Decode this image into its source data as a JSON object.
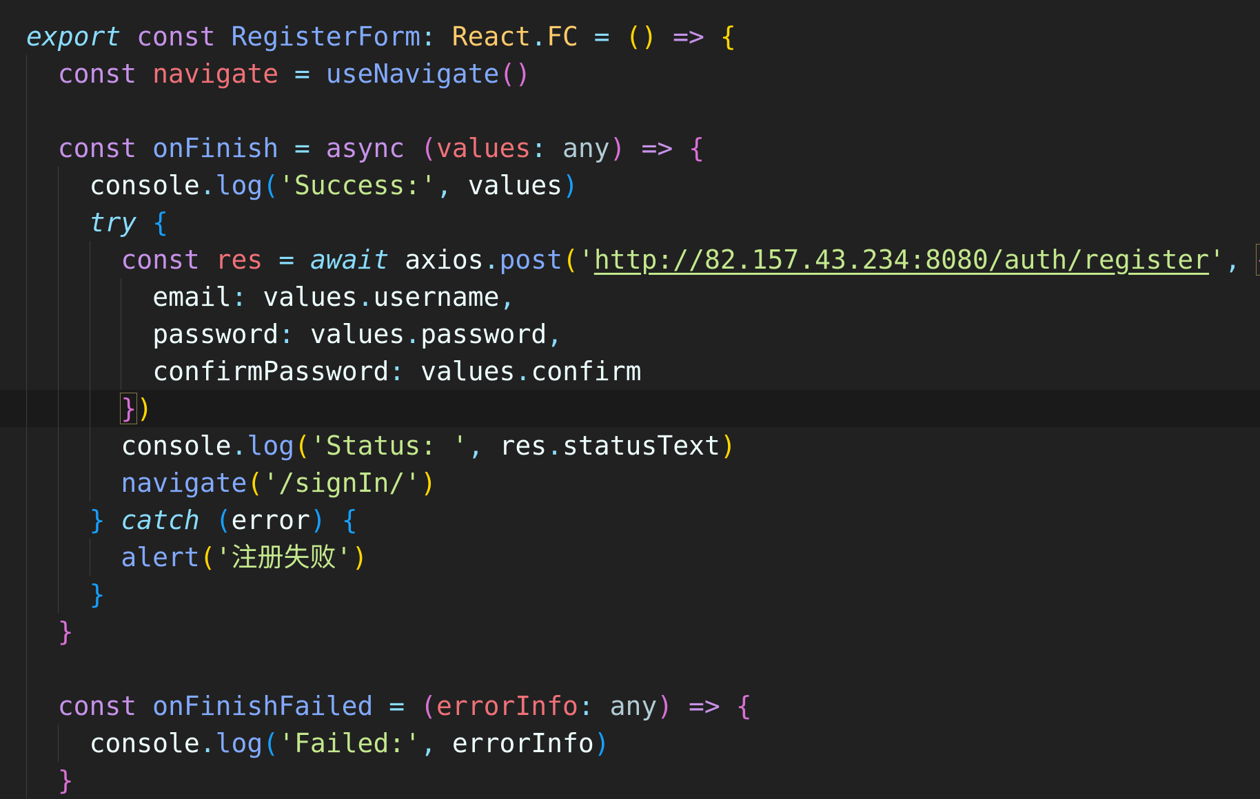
{
  "colors": {
    "background": "#212121",
    "current_line": "#1a1a1a",
    "keyword": "#c792ea",
    "storage_italic": "#89ddff",
    "function": "#82aaff",
    "variable_red": "#f07178",
    "type": "#ffcb6b",
    "string": "#c3e88d",
    "punct": "#89ddff",
    "plain": "#eeffff",
    "bracket_gold": "#ffd700",
    "bracket_pink": "#da70d6",
    "bracket_blue": "#179fff",
    "type_param": "#b2ccd6"
  },
  "editor": {
    "lines": [
      {
        "indent": 0,
        "tokens": [
          {
            "t": "export",
            "c": "storage_italic",
            "i": true
          },
          {
            "t": " "
          },
          {
            "t": "const",
            "c": "keyword"
          },
          {
            "t": " "
          },
          {
            "t": "RegisterForm",
            "c": "function"
          },
          {
            "t": ":",
            "c": "punct"
          },
          {
            "t": " "
          },
          {
            "t": "React",
            "c": "type"
          },
          {
            "t": ".",
            "c": "punct"
          },
          {
            "t": "FC",
            "c": "type"
          },
          {
            "t": " "
          },
          {
            "t": "=",
            "c": "punct"
          },
          {
            "t": " "
          },
          {
            "t": "()",
            "c": "bracket_gold"
          },
          {
            "t": " "
          },
          {
            "t": "=>",
            "c": "keyword"
          },
          {
            "t": " "
          },
          {
            "t": "{",
            "c": "bracket_gold"
          }
        ]
      },
      {
        "indent": 1,
        "tokens": [
          {
            "t": "const",
            "c": "keyword"
          },
          {
            "t": " "
          },
          {
            "t": "navigate",
            "c": "variable_red"
          },
          {
            "t": " "
          },
          {
            "t": "=",
            "c": "punct"
          },
          {
            "t": " "
          },
          {
            "t": "useNavigate",
            "c": "function"
          },
          {
            "t": "()",
            "c": "bracket_pink"
          }
        ]
      },
      {
        "indent": 1,
        "tokens": []
      },
      {
        "indent": 1,
        "tokens": [
          {
            "t": "const",
            "c": "keyword"
          },
          {
            "t": " "
          },
          {
            "t": "onFinish",
            "c": "function"
          },
          {
            "t": " "
          },
          {
            "t": "=",
            "c": "punct"
          },
          {
            "t": " "
          },
          {
            "t": "async",
            "c": "keyword"
          },
          {
            "t": " "
          },
          {
            "t": "(",
            "c": "bracket_pink"
          },
          {
            "t": "values",
            "c": "variable_red"
          },
          {
            "t": ":",
            "c": "punct"
          },
          {
            "t": " "
          },
          {
            "t": "any",
            "c": "type_param"
          },
          {
            "t": ")",
            "c": "bracket_pink"
          },
          {
            "t": " "
          },
          {
            "t": "=>",
            "c": "keyword"
          },
          {
            "t": " "
          },
          {
            "t": "{",
            "c": "bracket_pink"
          }
        ]
      },
      {
        "indent": 2,
        "tokens": [
          {
            "t": "console",
            "c": "plain"
          },
          {
            "t": ".",
            "c": "punct"
          },
          {
            "t": "log",
            "c": "function"
          },
          {
            "t": "(",
            "c": "bracket_blue"
          },
          {
            "t": "'Success:'",
            "c": "string"
          },
          {
            "t": ", ",
            "c": "punct"
          },
          {
            "t": "values",
            "c": "plain"
          },
          {
            "t": ")",
            "c": "bracket_blue"
          }
        ]
      },
      {
        "indent": 2,
        "tokens": [
          {
            "t": "try",
            "c": "storage_italic",
            "i": true
          },
          {
            "t": " "
          },
          {
            "t": "{",
            "c": "bracket_blue"
          }
        ]
      },
      {
        "indent": 3,
        "tokens": [
          {
            "t": "const",
            "c": "keyword"
          },
          {
            "t": " "
          },
          {
            "t": "res",
            "c": "variable_red"
          },
          {
            "t": " "
          },
          {
            "t": "=",
            "c": "punct"
          },
          {
            "t": " "
          },
          {
            "t": "await",
            "c": "storage_italic",
            "i": true
          },
          {
            "t": " "
          },
          {
            "t": "axios",
            "c": "plain"
          },
          {
            "t": ".",
            "c": "punct"
          },
          {
            "t": "post",
            "c": "function"
          },
          {
            "t": "(",
            "c": "bracket_gold"
          },
          {
            "t": "'",
            "c": "string"
          },
          {
            "t": "http://82.157.43.234:8080/auth/register",
            "c": "string",
            "u": true
          },
          {
            "t": "'",
            "c": "string"
          },
          {
            "t": ", ",
            "c": "punct"
          },
          {
            "t": "{",
            "c": "bracket_pink",
            "box": true
          }
        ]
      },
      {
        "indent": 4,
        "tokens": [
          {
            "t": "email",
            "c": "plain"
          },
          {
            "t": ":",
            "c": "punct"
          },
          {
            "t": " "
          },
          {
            "t": "values",
            "c": "plain"
          },
          {
            "t": ".",
            "c": "punct"
          },
          {
            "t": "username",
            "c": "plain"
          },
          {
            "t": ",",
            "c": "punct"
          }
        ]
      },
      {
        "indent": 4,
        "tokens": [
          {
            "t": "password",
            "c": "plain"
          },
          {
            "t": ":",
            "c": "punct"
          },
          {
            "t": " "
          },
          {
            "t": "values",
            "c": "plain"
          },
          {
            "t": ".",
            "c": "punct"
          },
          {
            "t": "password",
            "c": "plain"
          },
          {
            "t": ",",
            "c": "punct"
          }
        ]
      },
      {
        "indent": 4,
        "tokens": [
          {
            "t": "confirmPassword",
            "c": "plain"
          },
          {
            "t": ":",
            "c": "punct"
          },
          {
            "t": " "
          },
          {
            "t": "values",
            "c": "plain"
          },
          {
            "t": ".",
            "c": "punct"
          },
          {
            "t": "confirm",
            "c": "plain"
          }
        ]
      },
      {
        "indent": 3,
        "current": true,
        "tokens": [
          {
            "t": "}",
            "c": "bracket_pink",
            "box": true
          },
          {
            "t": ")",
            "c": "bracket_gold"
          }
        ]
      },
      {
        "indent": 3,
        "tokens": [
          {
            "t": "console",
            "c": "plain"
          },
          {
            "t": ".",
            "c": "punct"
          },
          {
            "t": "log",
            "c": "function"
          },
          {
            "t": "(",
            "c": "bracket_gold"
          },
          {
            "t": "'Status: '",
            "c": "string"
          },
          {
            "t": ", ",
            "c": "punct"
          },
          {
            "t": "res",
            "c": "plain"
          },
          {
            "t": ".",
            "c": "punct"
          },
          {
            "t": "statusText",
            "c": "plain"
          },
          {
            "t": ")",
            "c": "bracket_gold"
          }
        ]
      },
      {
        "indent": 3,
        "tokens": [
          {
            "t": "navigate",
            "c": "function"
          },
          {
            "t": "(",
            "c": "bracket_gold"
          },
          {
            "t": "'/signIn/'",
            "c": "string"
          },
          {
            "t": ")",
            "c": "bracket_gold"
          }
        ]
      },
      {
        "indent": 2,
        "tokens": [
          {
            "t": "}",
            "c": "bracket_blue"
          },
          {
            "t": " "
          },
          {
            "t": "catch",
            "c": "storage_italic",
            "i": true
          },
          {
            "t": " "
          },
          {
            "t": "(",
            "c": "bracket_blue"
          },
          {
            "t": "error",
            "c": "plain"
          },
          {
            "t": ")",
            "c": "bracket_blue"
          },
          {
            "t": " "
          },
          {
            "t": "{",
            "c": "bracket_blue"
          }
        ]
      },
      {
        "indent": 3,
        "tokens": [
          {
            "t": "alert",
            "c": "function"
          },
          {
            "t": "(",
            "c": "bracket_gold"
          },
          {
            "t": "'注册失败'",
            "c": "string"
          },
          {
            "t": ")",
            "c": "bracket_gold"
          }
        ]
      },
      {
        "indent": 2,
        "tokens": [
          {
            "t": "}",
            "c": "bracket_blue"
          }
        ]
      },
      {
        "indent": 1,
        "tokens": [
          {
            "t": "}",
            "c": "bracket_pink"
          }
        ]
      },
      {
        "indent": 1,
        "tokens": []
      },
      {
        "indent": 1,
        "tokens": [
          {
            "t": "const",
            "c": "keyword"
          },
          {
            "t": " "
          },
          {
            "t": "onFinishFailed",
            "c": "function"
          },
          {
            "t": " "
          },
          {
            "t": "=",
            "c": "punct"
          },
          {
            "t": " "
          },
          {
            "t": "(",
            "c": "bracket_pink"
          },
          {
            "t": "errorInfo",
            "c": "variable_red"
          },
          {
            "t": ":",
            "c": "punct"
          },
          {
            "t": " "
          },
          {
            "t": "any",
            "c": "type_param"
          },
          {
            "t": ")",
            "c": "bracket_pink"
          },
          {
            "t": " "
          },
          {
            "t": "=>",
            "c": "keyword"
          },
          {
            "t": " "
          },
          {
            "t": "{",
            "c": "bracket_pink"
          }
        ]
      },
      {
        "indent": 2,
        "tokens": [
          {
            "t": "console",
            "c": "plain"
          },
          {
            "t": ".",
            "c": "punct"
          },
          {
            "t": "log",
            "c": "function"
          },
          {
            "t": "(",
            "c": "bracket_blue"
          },
          {
            "t": "'Failed:'",
            "c": "string"
          },
          {
            "t": ", ",
            "c": "punct"
          },
          {
            "t": "errorInfo",
            "c": "plain"
          },
          {
            "t": ")",
            "c": "bracket_blue"
          }
        ]
      },
      {
        "indent": 1,
        "tokens": [
          {
            "t": "}",
            "c": "bracket_pink"
          }
        ]
      }
    ]
  }
}
